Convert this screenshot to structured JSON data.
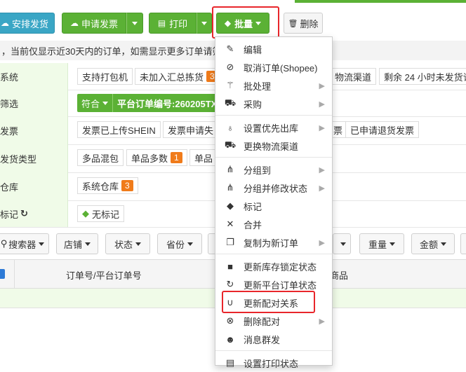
{
  "toolbar": {
    "arrange_shipping": "安排发货",
    "apply_invoice": "申请发票",
    "print": "打印",
    "batch": "批量",
    "delete": "删除"
  },
  "notice": "，当前仅显示近30天内的订单，如需显示更多订单请筛",
  "filters": {
    "row1": {
      "label": "系统",
      "chips": [
        "支持打包机",
        "未加入汇总拣货",
        "3",
        "物流渠道",
        "剩余 24 小时未发货订"
      ]
    },
    "row2": {
      "label": "筛选",
      "match": "符合",
      "order_no": "平台订单编号:260205TX"
    },
    "row3": {
      "label": "发票",
      "chips": [
        "发票已上传SHEIN",
        "发票申请失",
        "票",
        "已申请退货发票"
      ]
    },
    "row4": {
      "label": "发货类型",
      "chips": [
        "多品混包",
        "单品多数",
        "1",
        "单品"
      ]
    },
    "row5": {
      "label": "仓库",
      "chips": [
        "系统仓库",
        "3"
      ]
    },
    "row6": {
      "label": "标记",
      "chips": [
        "无标记"
      ]
    }
  },
  "filter_buttons": [
    "搜索器",
    "店铺",
    "状态",
    "省份",
    "重量",
    "金额"
  ],
  "table": {
    "header_order": "订单号/平台订单号",
    "header_product": "商品"
  },
  "batch_menu": {
    "items": [
      {
        "label": "编辑",
        "icon": "edit-icon"
      },
      {
        "label": "取消订单(Shopee)",
        "icon": "ban-icon"
      },
      {
        "label": "批处理",
        "icon": "magic-icon"
      },
      {
        "label": "采购",
        "icon": "cart-icon"
      },
      {
        "label": "设置优先出库",
        "icon": "bulb-icon"
      },
      {
        "label": "更换物流渠道",
        "icon": "truck-icon"
      },
      {
        "label": "分组到",
        "icon": "sitemap-icon"
      },
      {
        "label": "分组并修改状态",
        "icon": "sitemap-icon"
      },
      {
        "label": "标记",
        "icon": "tag-icon"
      },
      {
        "label": "合并",
        "icon": "merge-icon"
      },
      {
        "label": "复制为新订单",
        "icon": "copy-icon"
      },
      {
        "label": "更新库存锁定状态",
        "icon": "lock-icon"
      },
      {
        "label": "更新平台订单状态",
        "icon": "refresh-icon"
      },
      {
        "label": "更新配对关系",
        "icon": "magnet-icon"
      },
      {
        "label": "删除配对",
        "icon": "close-circle-icon"
      },
      {
        "label": "消息群发",
        "icon": "users-icon"
      },
      {
        "label": "设置打印状态",
        "icon": "print-icon"
      }
    ]
  },
  "colors": {
    "green": "#5bb135",
    "teal": "#3aa6c5",
    "highlight": "#e8262b",
    "badge": "#f07b1a"
  }
}
